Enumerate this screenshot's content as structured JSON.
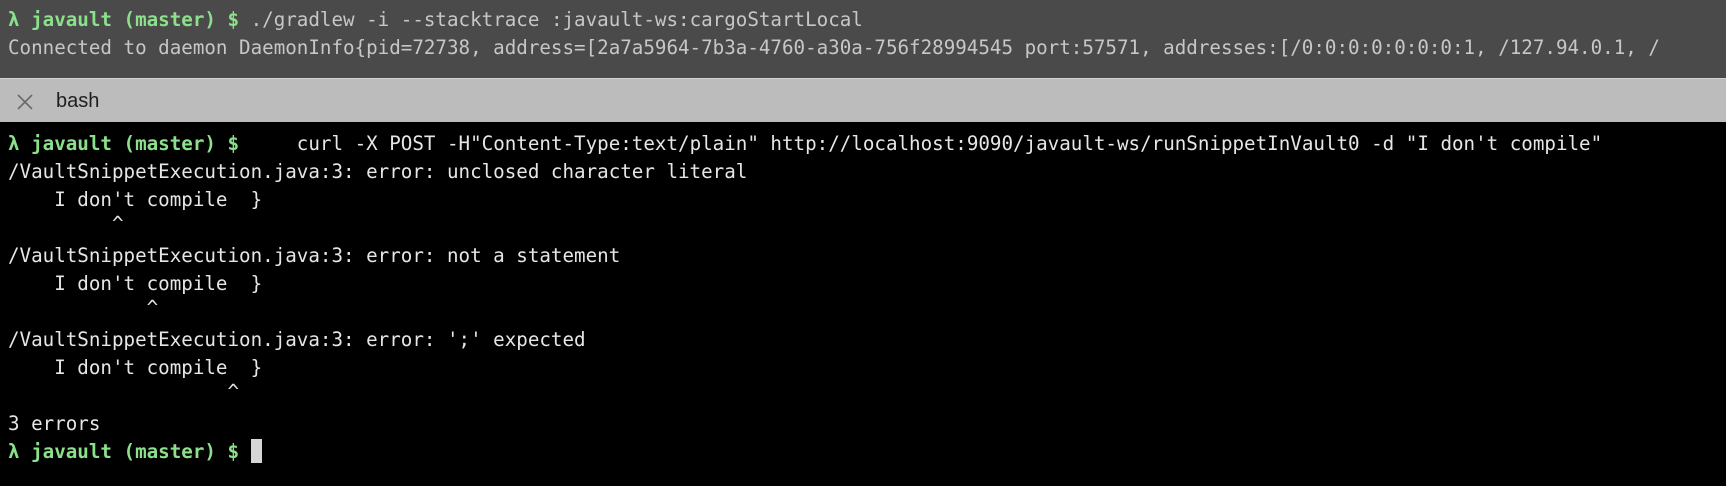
{
  "top_pane": {
    "prompt": "λ javault (master) $",
    "command": " ./gradlew -i --stacktrace :javault-ws:cargoStartLocal",
    "output": "Connected to daemon DaemonInfo{pid=72738, address=[2a7a5964-7b3a-4760-a30a-756f28994545 port:57571, addresses:[/0:0:0:0:0:0:0:1, /127.94.0.1, /"
  },
  "tab": {
    "title": "bash",
    "close_icon": "close-icon"
  },
  "terminal": {
    "prompt": "λ javault (master) $",
    "command": "     curl -X POST -H\"Content-Type:text/plain\" http://localhost:9090/javault-ws/runSnippetInVault0 -d \"I don't compile\"",
    "output_lines": [
      "/VaultSnippetExecution.java:3: error: unclosed character literal",
      "    I don't compile  }",
      "         ^",
      "/VaultSnippetExecution.java:3: error: not a statement",
      "    I don't compile  }",
      "            ^",
      "/VaultSnippetExecution.java:3: error: ';' expected",
      "    I don't compile  }",
      "                   ^",
      "3 errors"
    ],
    "final_prompt": "λ javault (master) $"
  },
  "colors": {
    "prompt_green": "#8be08b",
    "top_pane_bg": "#4a4a4a",
    "tab_bar_bg": "#bcbcbc",
    "terminal_bg": "#000000"
  }
}
